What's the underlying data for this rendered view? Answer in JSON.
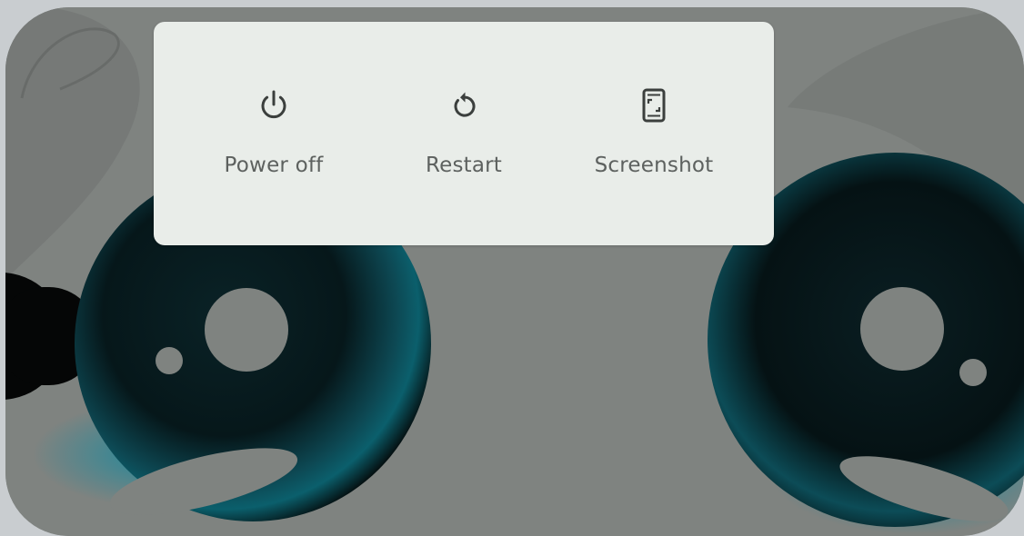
{
  "power_menu": {
    "actions": [
      {
        "label": "Power off",
        "icon": "power-icon"
      },
      {
        "label": "Restart",
        "icon": "restart-icon"
      },
      {
        "label": "Screenshot",
        "icon": "screenshot-icon"
      }
    ]
  },
  "colors": {
    "menu_background": "#e9ede9",
    "label_text": "#5d615f",
    "icon": "#3b3f3d",
    "wallpaper_gray": "#7f8380",
    "eye_accent": "#0e7d8e"
  }
}
